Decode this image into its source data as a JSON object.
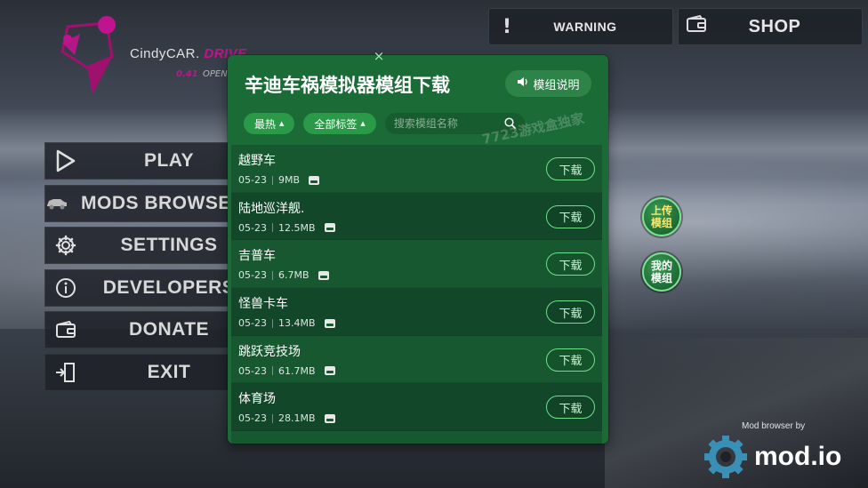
{
  "game": {
    "logo_name": "CindyCAR.",
    "logo_accent": "DRIVE",
    "version": "0.41",
    "sub": "OPEN"
  },
  "top_buttons": {
    "warning": {
      "label": "WARNING",
      "icon": "exclamation-icon"
    },
    "shop": {
      "label": "SHOP",
      "icon": "wallet-icon"
    }
  },
  "menu": [
    {
      "label": "PLAY",
      "icon": "play-icon"
    },
    {
      "label": "MODS BROWSER",
      "icon": "car-icon"
    },
    {
      "label": "SETTINGS",
      "icon": "gear-icon"
    },
    {
      "label": "DEVELOPERS",
      "icon": "info-icon"
    },
    {
      "label": "DONATE",
      "icon": "wallet-icon"
    },
    {
      "label": "EXIT",
      "icon": "exit-door-icon"
    }
  ],
  "modal": {
    "title": "辛迪车祸模拟器模组下载",
    "help_label": "模组说明",
    "close_glyph": "×",
    "filters": {
      "sort": "最热",
      "tags": "全部标签",
      "search_placeholder": "搜索模组名称"
    },
    "watermark": "7723游戏盒独家",
    "download_label": "下载",
    "mods": [
      {
        "name": "越野车",
        "date": "05-23",
        "size": "9MB"
      },
      {
        "name": "陆地巡洋舰.",
        "date": "05-23",
        "size": "12.5MB"
      },
      {
        "name": "吉普车",
        "date": "05-23",
        "size": "6.7MB"
      },
      {
        "name": "怪兽卡车",
        "date": "05-23",
        "size": "13.4MB"
      },
      {
        "name": "跳跃竞技场",
        "date": "05-23",
        "size": "61.7MB"
      },
      {
        "name": "体育场",
        "date": "05-23",
        "size": "28.1MB"
      }
    ]
  },
  "side_buttons": {
    "upload": "上传\n模组",
    "upload_line1": "上传",
    "upload_line2": "模组",
    "mymods_line1": "我的",
    "mymods_line2": "模组"
  },
  "modio": {
    "caption": "Mod browser by",
    "brand": "mod.io"
  },
  "colors": {
    "modal_bg": "#1a6b36",
    "accent_green": "#2a9a48",
    "download_border": "#6fe08a",
    "logo_magenta": "#c0148e",
    "upload_text": "#ffe86a"
  }
}
